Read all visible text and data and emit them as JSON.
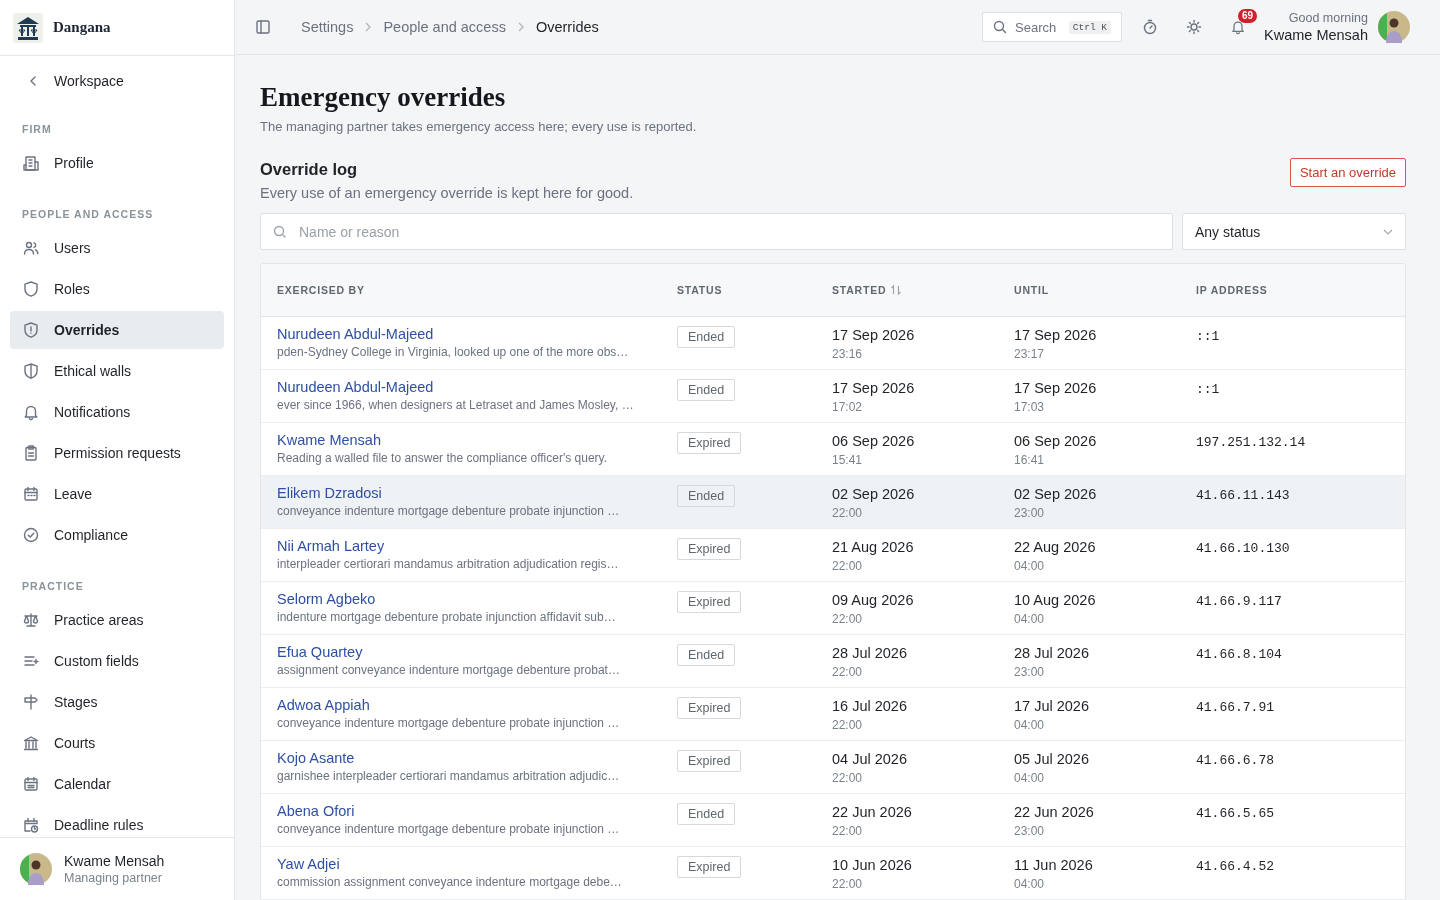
{
  "brand": {
    "name": "Dangana"
  },
  "sidebar": {
    "back_link": "Workspace",
    "sections": [
      {
        "heading": "FIRM",
        "items": [
          {
            "label": "Profile",
            "selected": false
          }
        ]
      },
      {
        "heading": "PEOPLE AND ACCESS",
        "items": [
          {
            "label": "Users",
            "selected": false
          },
          {
            "label": "Roles",
            "selected": false
          },
          {
            "label": "Overrides",
            "selected": true
          },
          {
            "label": "Ethical walls",
            "selected": false
          },
          {
            "label": "Notifications",
            "selected": false
          },
          {
            "label": "Permission requests",
            "selected": false
          },
          {
            "label": "Leave",
            "selected": false
          },
          {
            "label": "Compliance",
            "selected": false
          }
        ]
      },
      {
        "heading": "PRACTICE",
        "items": [
          {
            "label": "Practice areas",
            "selected": false
          },
          {
            "label": "Custom fields",
            "selected": false
          },
          {
            "label": "Stages",
            "selected": false
          },
          {
            "label": "Courts",
            "selected": false
          },
          {
            "label": "Calendar",
            "selected": false
          },
          {
            "label": "Deadline rules",
            "selected": false
          }
        ]
      }
    ],
    "user": {
      "name": "Kwame Mensah",
      "role": "Managing partner"
    }
  },
  "topbar": {
    "breadcrumb": [
      "Settings",
      "People and access",
      "Overrides"
    ],
    "search": {
      "placeholder": "Search",
      "shortcut": "Ctrl K"
    },
    "notifications": {
      "count": "69"
    },
    "greeting": "Good morning",
    "user_name": "Kwame Mensah"
  },
  "page": {
    "title": "Emergency overrides",
    "subtitle": "The managing partner takes emergency access here; every use is reported.",
    "section_title": "Override log",
    "section_description": "Every use of an emergency override is kept here for good.",
    "action_button": "Start an override",
    "filter": {
      "placeholder": "Name or reason"
    },
    "status_select": {
      "value": "Any status"
    }
  },
  "table": {
    "columns": [
      {
        "label": "EXERCISED BY",
        "sortable": false
      },
      {
        "label": "STATUS",
        "sortable": false
      },
      {
        "label": "STARTED",
        "sortable": true
      },
      {
        "label": "UNTIL",
        "sortable": false
      },
      {
        "label": "IP ADDRESS",
        "sortable": false
      }
    ],
    "rows": [
      {
        "name": "Nurudeen Abdul-Majeed",
        "reason": "pden-Sydney College in Virginia, looked up one of the more obs…",
        "status": "Ended",
        "started_date": "17 Sep 2026",
        "started_time": "23:16",
        "until_date": "17 Sep 2026",
        "until_time": "23:17",
        "ip": "::1",
        "highlighted": false
      },
      {
        "name": "Nurudeen Abdul-Majeed",
        "reason": "ever since 1966, when designers at Letraset and James Mosley, …",
        "status": "Ended",
        "started_date": "17 Sep 2026",
        "started_time": "17:02",
        "until_date": "17 Sep 2026",
        "until_time": "17:03",
        "ip": "::1",
        "highlighted": false
      },
      {
        "name": "Kwame Mensah",
        "reason": "Reading a walled file to answer the compliance officer's query.",
        "status": "Expired",
        "started_date": "06 Sep 2026",
        "started_time": "15:41",
        "until_date": "06 Sep 2026",
        "until_time": "16:41",
        "ip": "197.251.132.14",
        "highlighted": false
      },
      {
        "name": "Elikem Dzradosi",
        "reason": "conveyance indenture mortgage debenture probate injunction …",
        "status": "Ended",
        "started_date": "02 Sep 2026",
        "started_time": "22:00",
        "until_date": "02 Sep 2026",
        "until_time": "23:00",
        "ip": "41.66.11.143",
        "highlighted": true
      },
      {
        "name": "Nii Armah Lartey",
        "reason": "interpleader certiorari mandamus arbitration adjudication regis…",
        "status": "Expired",
        "started_date": "21 Aug 2026",
        "started_time": "22:00",
        "until_date": "22 Aug 2026",
        "until_time": "04:00",
        "ip": "41.66.10.130",
        "highlighted": false
      },
      {
        "name": "Selorm Agbeko",
        "reason": "indenture mortgage debenture probate injunction affidavit sub…",
        "status": "Expired",
        "started_date": "09 Aug 2026",
        "started_time": "22:00",
        "until_date": "10 Aug 2026",
        "until_time": "04:00",
        "ip": "41.66.9.117",
        "highlighted": false
      },
      {
        "name": "Efua Quartey",
        "reason": "assignment conveyance indenture mortgage debenture probat…",
        "status": "Ended",
        "started_date": "28 Jul 2026",
        "started_time": "22:00",
        "until_date": "28 Jul 2026",
        "until_time": "23:00",
        "ip": "41.66.8.104",
        "highlighted": false
      },
      {
        "name": "Adwoa Appiah",
        "reason": "conveyance indenture mortgage debenture probate injunction …",
        "status": "Expired",
        "started_date": "16 Jul 2026",
        "started_time": "22:00",
        "until_date": "17 Jul 2026",
        "until_time": "04:00",
        "ip": "41.66.7.91",
        "highlighted": false
      },
      {
        "name": "Kojo Asante",
        "reason": "garnishee interpleader certiorari mandamus arbitration adjudic…",
        "status": "Expired",
        "started_date": "04 Jul 2026",
        "started_time": "22:00",
        "until_date": "05 Jul 2026",
        "until_time": "04:00",
        "ip": "41.66.6.78",
        "highlighted": false
      },
      {
        "name": "Abena Ofori",
        "reason": "conveyance indenture mortgage debenture probate injunction …",
        "status": "Ended",
        "started_date": "22 Jun 2026",
        "started_time": "22:00",
        "until_date": "22 Jun 2026",
        "until_time": "23:00",
        "ip": "41.66.5.65",
        "highlighted": false
      },
      {
        "name": "Yaw Adjei",
        "reason": "commission assignment conveyance indenture mortgage debe…",
        "status": "Expired",
        "started_date": "10 Jun 2026",
        "started_time": "22:00",
        "until_date": "11 Jun 2026",
        "until_time": "04:00",
        "ip": "41.66.4.52",
        "highlighted": false
      }
    ]
  }
}
